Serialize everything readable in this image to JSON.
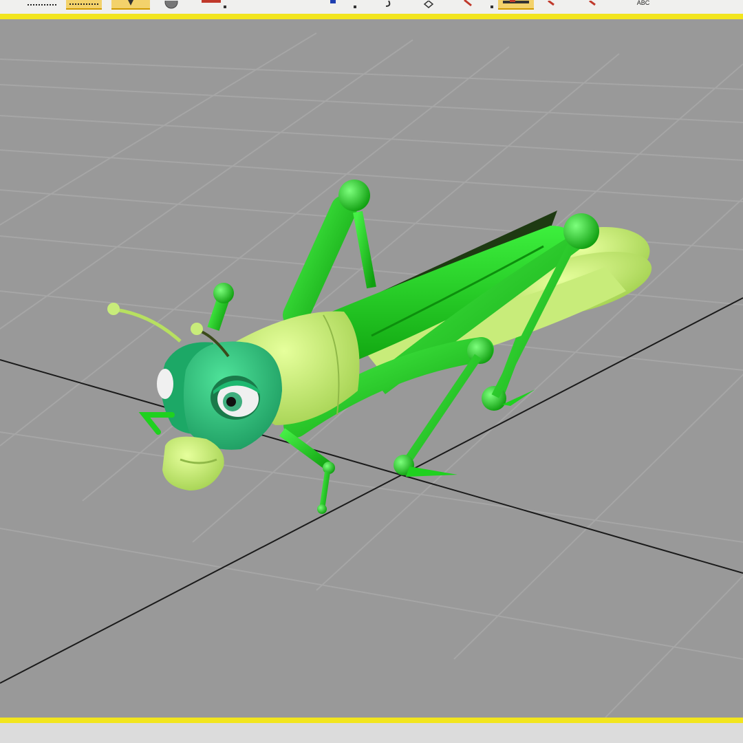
{
  "toolbar": {
    "items": [
      {
        "icon": "dotted-line-icon",
        "active": false
      },
      {
        "icon": "dotted-line-active-icon",
        "active": true
      },
      {
        "icon": "select-cursor-icon",
        "active": true
      },
      {
        "icon": "sphere-icon",
        "active": false
      },
      {
        "icon": "color-swatch-icon",
        "active": false
      },
      {
        "icon": "blue-square-icon",
        "active": false
      },
      {
        "icon": "hook-icon",
        "active": false
      },
      {
        "icon": "diamond-icon",
        "active": false
      },
      {
        "icon": "pen-icon",
        "active": false
      },
      {
        "icon": "highlight-icon",
        "active": true
      },
      {
        "icon": "pointer-icon",
        "active": false
      },
      {
        "icon": "pointer-alt-icon",
        "active": false
      }
    ],
    "text_tool_label": "ABC"
  },
  "viewport": {
    "content": "grasshopper-3d-model",
    "border_color": "#f2e51e",
    "background_color": "#999999",
    "grid_color": "#a3a3a3",
    "axis_color": "#1a1a1a"
  },
  "colors": {
    "body_green": "#1fd11f",
    "pale_green": "#c8ec7a",
    "head_teal": "#2ac77a",
    "wing_dark": "#1e3a12"
  }
}
